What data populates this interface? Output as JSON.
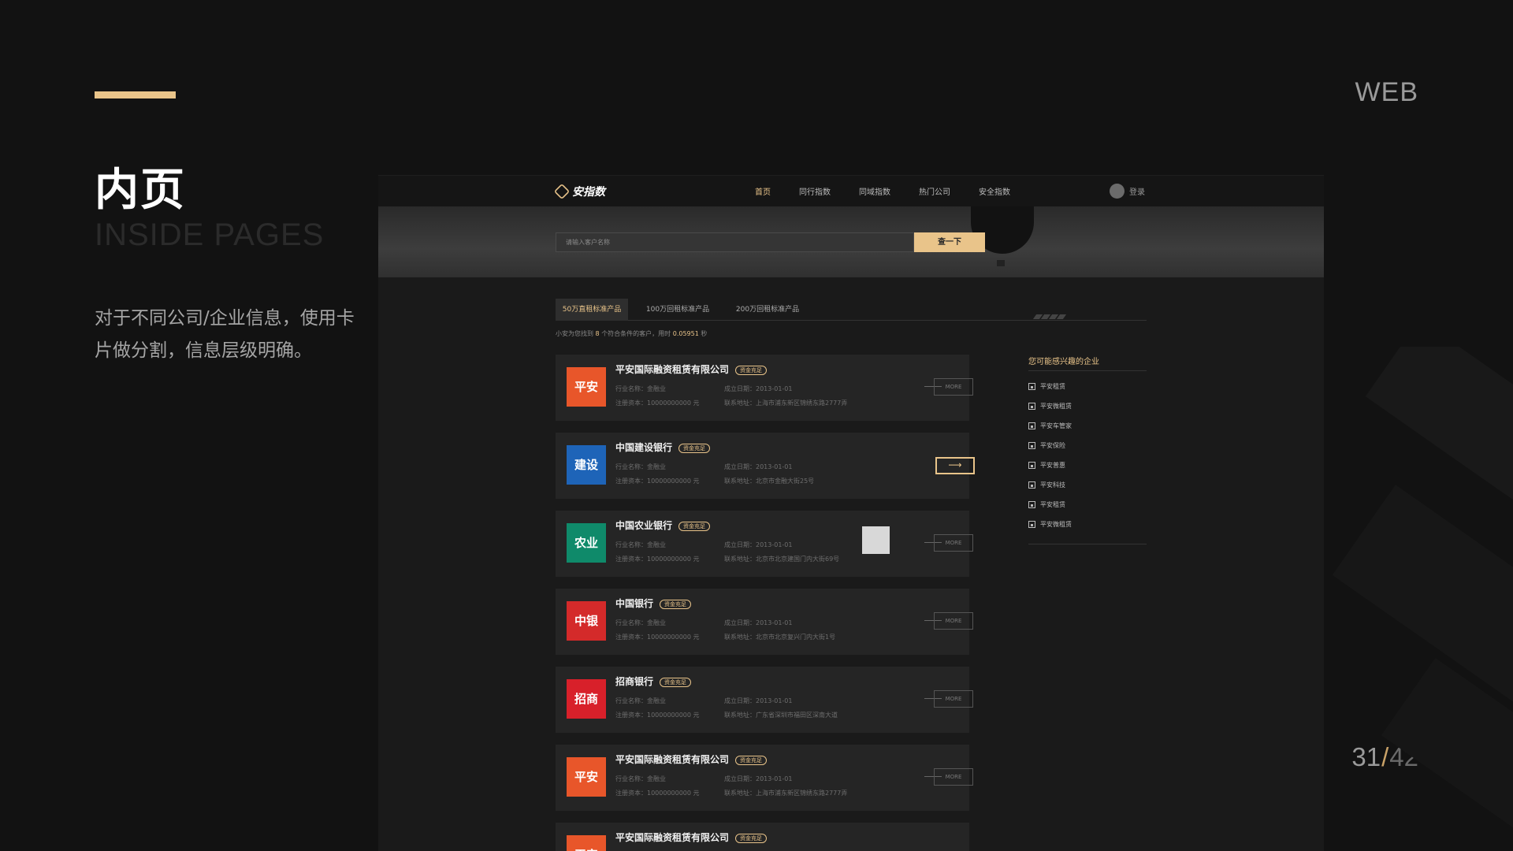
{
  "slide": {
    "title": "内页",
    "subtitle": "INSIDE PAGES",
    "description": "对于不同公司/企业信息，使用卡片做分割，信息层级明确。",
    "web_label": "WEB",
    "page_current": "31",
    "page_separator": "/",
    "page_total": "42",
    "accent_color": "#e9c48a"
  },
  "site": {
    "logo_text": "安指数",
    "nav": [
      "首页",
      "同行指数",
      "同域指数",
      "热门公司",
      "安全指数"
    ],
    "login": "登录",
    "search_placeholder": "请输入客户名称",
    "search_button": "查一下",
    "tabs": [
      "50万直租标准产品",
      "100万回租标准产品",
      "200万回租标准产品"
    ],
    "result_prefix": "小安为您找到",
    "result_count": "8",
    "result_mid": "个符合条件的客户，用时",
    "result_time": "0.05951",
    "result_suffix": "秒",
    "more_label": "MORE",
    "arrow_label": "⟶",
    "cards": [
      {
        "logo": "平安",
        "color": "#e8562a",
        "name": "平安国际融资租赁有限公司",
        "badge": "资金充足",
        "industry": "行业名称：金融业",
        "capital": "注册资本：10000000000 元",
        "founded": "成立日期：2013-01-01",
        "address": "联系地址：上海市浦东新区锦绣东路2777弄"
      },
      {
        "logo": "建设",
        "color": "#1e64b8",
        "name": "中国建设银行",
        "badge": "资金充足",
        "industry": "行业名称：金融业",
        "capital": "注册资本：10000000000 元",
        "founded": "成立日期：2013-01-01",
        "address": "联系地址：北京市金融大街25号"
      },
      {
        "logo": "农业",
        "color": "#0f8a6a",
        "name": "中国农业银行",
        "badge": "资金充足",
        "industry": "行业名称：金融业",
        "capital": "注册资本：10000000000 元",
        "founded": "成立日期：2013-01-01",
        "address": "联系地址：北京市北京建国门内大街69号"
      },
      {
        "logo": "中银",
        "color": "#d42a2a",
        "name": "中国银行",
        "badge": "资金充足",
        "industry": "行业名称：金融业",
        "capital": "注册资本：10000000000 元",
        "founded": "成立日期：2013-01-01",
        "address": "联系地址：北京市北京复兴门内大街1号"
      },
      {
        "logo": "招商",
        "color": "#d8202a",
        "name": "招商银行",
        "badge": "资金充足",
        "industry": "行业名称：金融业",
        "capital": "注册资本：10000000000 元",
        "founded": "成立日期：2013-01-01",
        "address": "联系地址：广东省深圳市福田区深南大道"
      },
      {
        "logo": "平安",
        "color": "#e8562a",
        "name": "平安国际融资租赁有限公司",
        "badge": "资金充足",
        "industry": "行业名称：金融业",
        "capital": "注册资本：10000000000 元",
        "founded": "成立日期：2013-01-01",
        "address": "联系地址：上海市浦东新区锦绣东路2777弄"
      },
      {
        "logo": "平安",
        "color": "#e8562a",
        "name": "平安国际融资租赁有限公司",
        "badge": "资金充足",
        "industry": "",
        "capital": "",
        "founded": "",
        "address": ""
      }
    ],
    "side_title": "您可能感兴趣的企业",
    "side_items": [
      "平安租赁",
      "平安微租赁",
      "平安车管家",
      "平安保险",
      "平安普惠",
      "平安科技",
      "平安租赁",
      "平安微租赁"
    ]
  }
}
